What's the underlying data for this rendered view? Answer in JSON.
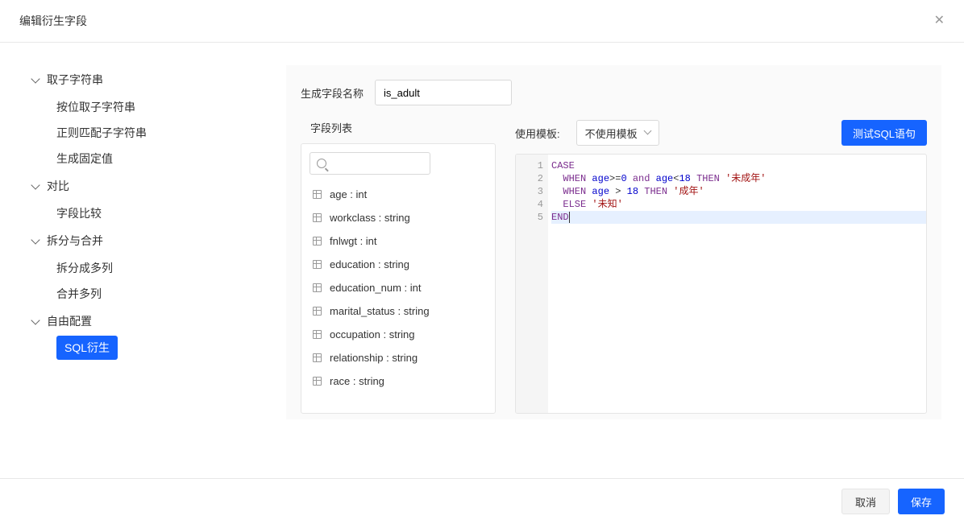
{
  "header": {
    "title": "编辑衍生字段"
  },
  "sidebar": {
    "groups": [
      {
        "title": "取子字符串",
        "items": [
          {
            "label": "按位取子字符串"
          },
          {
            "label": "正则匹配子字符串"
          },
          {
            "label": "生成固定值"
          }
        ]
      },
      {
        "title": "对比",
        "items": [
          {
            "label": "字段比较"
          }
        ]
      },
      {
        "title": "拆分与合并",
        "items": [
          {
            "label": "拆分成多列"
          },
          {
            "label": "合并多列"
          }
        ]
      },
      {
        "title": "自由配置",
        "items": [
          {
            "label": "SQL衍生",
            "active": true
          }
        ]
      }
    ]
  },
  "form": {
    "field_name_label": "生成字段名称",
    "field_name_value": "is_adult",
    "field_list_label": "字段列表",
    "template_label": "使用模板:",
    "template_value": "不使用模板",
    "test_button": "测试SQL语句"
  },
  "fields": [
    "age : int",
    "workclass : string",
    "fnlwgt : int",
    "education : string",
    "education_num : int",
    "marital_status : string",
    "occupation : string",
    "relationship : string",
    "race : string"
  ],
  "code": {
    "line_count": 5,
    "raw": "CASE\n  WHEN age>=0 and age<18 THEN '未成年'\n  WHEN age > 18 THEN '成年'\n  ELSE '未知'\nEND"
  },
  "footer": {
    "cancel": "取消",
    "save": "保存"
  }
}
